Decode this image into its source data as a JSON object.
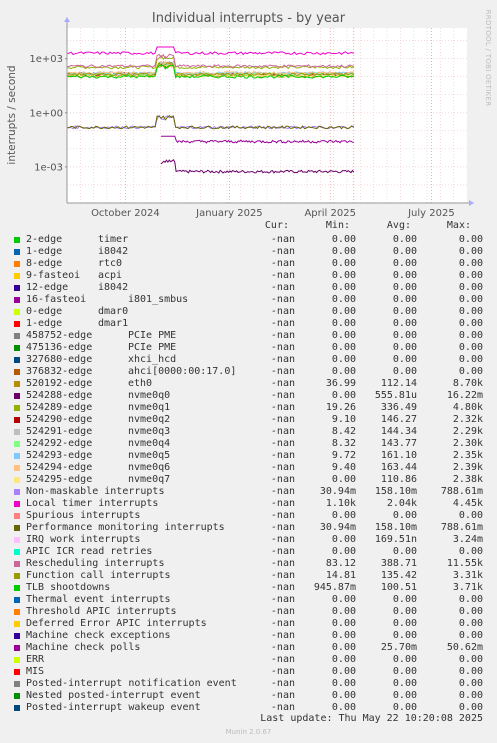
{
  "title": "Individual interrupts - by year",
  "watermark": "RRDTOOL / TOBI OETIKER",
  "version": "Munin 2.0.67",
  "last_update": "Last update: Thu May 22 10:20:08 2025",
  "legend_headers": {
    "cur": "Cur:",
    "min": "Min:",
    "avg": "Avg:",
    "max": "Max:"
  },
  "chart_data": {
    "type": "line",
    "title": "Individual interrupts - by year",
    "ylabel": "interrupts / second",
    "yscale": "log",
    "ylim": [
      1e-05,
      50000
    ],
    "yticks": [
      {
        "value": 1000,
        "label": "1e+03"
      },
      {
        "value": 1,
        "label": "1e+00"
      },
      {
        "value": 0.001,
        "label": "1e-03"
      }
    ],
    "xticks": [
      {
        "t": 0.146,
        "label": "October 2024"
      },
      {
        "t": 0.406,
        "label": "January 2025"
      },
      {
        "t": 0.658,
        "label": "April 2025"
      },
      {
        "t": 0.911,
        "label": "July 2025"
      }
    ],
    "grid": true,
    "series": [
      {
        "name": "2-edge",
        "label2": "timer",
        "color": "#00cc00",
        "cur": "-nan",
        "min": "0.00",
        "avg": "0.00",
        "max": "0.00"
      },
      {
        "name": "1-edge",
        "label2": "i8042",
        "color": "#0066b3",
        "cur": "-nan",
        "min": "0.00",
        "avg": "0.00",
        "max": "0.00"
      },
      {
        "name": "8-edge",
        "label2": "rtc0",
        "color": "#ff8000",
        "cur": "-nan",
        "min": "0.00",
        "avg": "0.00",
        "max": "0.00"
      },
      {
        "name": "9-fasteoi",
        "label2": "acpi",
        "color": "#ffcc00",
        "cur": "-nan",
        "min": "0.00",
        "avg": "0.00",
        "max": "0.00"
      },
      {
        "name": "12-edge",
        "label2": "i8042",
        "color": "#330099",
        "cur": "-nan",
        "min": "0.00",
        "avg": "0.00",
        "max": "0.00"
      },
      {
        "name": "16-fasteoi",
        "label2": "i801_smbus",
        "color": "#990099",
        "cur": "-nan",
        "min": "0.00",
        "avg": "0.00",
        "max": "0.00"
      },
      {
        "name": "0-edge",
        "label2": "dmar0",
        "color": "#ccff00",
        "cur": "-nan",
        "min": "0.00",
        "avg": "0.00",
        "max": "0.00"
      },
      {
        "name": "1-edge",
        "label2": "dmar1",
        "color": "#ff0000",
        "cur": "-nan",
        "min": "0.00",
        "avg": "0.00",
        "max": "0.00"
      },
      {
        "name": "458752-edge",
        "label2": "PCIe PME",
        "color": "#808080",
        "cur": "-nan",
        "min": "0.00",
        "avg": "0.00",
        "max": "0.00"
      },
      {
        "name": "475136-edge",
        "label2": "PCIe PME",
        "color": "#008f00",
        "cur": "-nan",
        "min": "0.00",
        "avg": "0.00",
        "max": "0.00"
      },
      {
        "name": "327680-edge",
        "label2": "xhci_hcd",
        "color": "#00487d",
        "cur": "-nan",
        "min": "0.00",
        "avg": "0.00",
        "max": "0.00"
      },
      {
        "name": "376832-edge",
        "label2": "ahci[0000:00:17.0]",
        "color": "#b35a00",
        "cur": "-nan",
        "min": "0.00",
        "avg": "0.00",
        "max": "0.00"
      },
      {
        "name": "520192-edge",
        "label2": "eth0",
        "color": "#b38f00",
        "cur": "-nan",
        "min": "36.99",
        "avg": "112.14",
        "max": "8.70k"
      },
      {
        "name": "524288-edge",
        "label2": "nvme0q0",
        "color": "#6b006b",
        "cur": "-nan",
        "min": "0.00",
        "avg": "555.81u",
        "max": "16.22m"
      },
      {
        "name": "524289-edge",
        "label2": "nvme0q1",
        "color": "#8fb300",
        "cur": "-nan",
        "min": "19.26",
        "avg": "336.49",
        "max": "4.80k"
      },
      {
        "name": "524290-edge",
        "label2": "nvme0q2",
        "color": "#b30000",
        "cur": "-nan",
        "min": "9.10",
        "avg": "146.27",
        "max": "2.32k"
      },
      {
        "name": "524291-edge",
        "label2": "nvme0q3",
        "color": "#bebebe",
        "cur": "-nan",
        "min": "8.42",
        "avg": "144.34",
        "max": "2.29k"
      },
      {
        "name": "524292-edge",
        "label2": "nvme0q4",
        "color": "#80ff80",
        "cur": "-nan",
        "min": "8.32",
        "avg": "143.77",
        "max": "2.30k"
      },
      {
        "name": "524293-edge",
        "label2": "nvme0q5",
        "color": "#80c9ff",
        "cur": "-nan",
        "min": "9.72",
        "avg": "161.10",
        "max": "2.35k"
      },
      {
        "name": "524294-edge",
        "label2": "nvme0q6",
        "color": "#ffc080",
        "cur": "-nan",
        "min": "9.40",
        "avg": "163.44",
        "max": "2.39k"
      },
      {
        "name": "524295-edge",
        "label2": "nvme0q7",
        "color": "#ffe680",
        "cur": "-nan",
        "min": "0.00",
        "avg": "110.86",
        "max": "2.38k"
      },
      {
        "name": "Non-maskable interrupts",
        "label2": "",
        "color": "#aa80ff",
        "cur": "-nan",
        "min": "30.94m",
        "avg": "158.10m",
        "max": "788.61m"
      },
      {
        "name": "Local timer interrupts",
        "label2": "",
        "color": "#ee00cc",
        "cur": "-nan",
        "min": "1.10k",
        "avg": "2.04k",
        "max": "4.45k"
      },
      {
        "name": "Spurious interrupts",
        "label2": "",
        "color": "#ff8080",
        "cur": "-nan",
        "min": "0.00",
        "avg": "0.00",
        "max": "0.00"
      },
      {
        "name": "Performance monitoring interrupts",
        "label2": "",
        "color": "#666600",
        "cur": "-nan",
        "min": "30.94m",
        "avg": "158.10m",
        "max": "788.61m"
      },
      {
        "name": "IRQ work interrupts",
        "label2": "",
        "color": "#ffbfff",
        "cur": "-nan",
        "min": "0.00",
        "avg": "169.51n",
        "max": "3.24m"
      },
      {
        "name": "APIC ICR read retries",
        "label2": "",
        "color": "#00ffcc",
        "cur": "-nan",
        "min": "0.00",
        "avg": "0.00",
        "max": "0.00"
      },
      {
        "name": "Rescheduling interrupts",
        "label2": "",
        "color": "#cc6699",
        "cur": "-nan",
        "min": "83.12",
        "avg": "388.71",
        "max": "11.55k"
      },
      {
        "name": "Function call interrupts",
        "label2": "",
        "color": "#999900",
        "cur": "-nan",
        "min": "14.81",
        "avg": "135.42",
        "max": "3.31k"
      },
      {
        "name": "TLB shootdowns",
        "label2": "",
        "color": "#00cc00",
        "cur": "-nan",
        "min": "945.87m",
        "avg": "100.51",
        "max": "3.71k"
      },
      {
        "name": "Thermal event interrupts",
        "label2": "",
        "color": "#0066b3",
        "cur": "-nan",
        "min": "0.00",
        "avg": "0.00",
        "max": "0.00"
      },
      {
        "name": "Threshold APIC interrupts",
        "label2": "",
        "color": "#ff8000",
        "cur": "-nan",
        "min": "0.00",
        "avg": "0.00",
        "max": "0.00"
      },
      {
        "name": "Deferred Error APIC interrupts",
        "label2": "",
        "color": "#ffcc00",
        "cur": "-nan",
        "min": "0.00",
        "avg": "0.00",
        "max": "0.00"
      },
      {
        "name": "Machine check exceptions",
        "label2": "",
        "color": "#330099",
        "cur": "-nan",
        "min": "0.00",
        "avg": "0.00",
        "max": "0.00"
      },
      {
        "name": "Machine check polls",
        "label2": "",
        "color": "#990099",
        "cur": "-nan",
        "min": "0.00",
        "avg": "25.70m",
        "max": "50.62m"
      },
      {
        "name": "ERR",
        "label2": "",
        "color": "#ccff00",
        "cur": "-nan",
        "min": "0.00",
        "avg": "0.00",
        "max": "0.00"
      },
      {
        "name": "MIS",
        "label2": "",
        "color": "#ff0000",
        "cur": "-nan",
        "min": "0.00",
        "avg": "0.00",
        "max": "0.00"
      },
      {
        "name": "Posted-interrupt notification event",
        "label2": "",
        "color": "#808080",
        "cur": "-nan",
        "min": "0.00",
        "avg": "0.00",
        "max": "0.00"
      },
      {
        "name": "Nested posted-interrupt event",
        "label2": "",
        "color": "#008f00",
        "cur": "-nan",
        "min": "0.00",
        "avg": "0.00",
        "max": "0.00"
      },
      {
        "name": "Posted-interrupt wakeup event",
        "label2": "",
        "color": "#00487d",
        "cur": "-nan",
        "min": "0.00",
        "avg": "0.00",
        "max": "0.00"
      }
    ]
  }
}
